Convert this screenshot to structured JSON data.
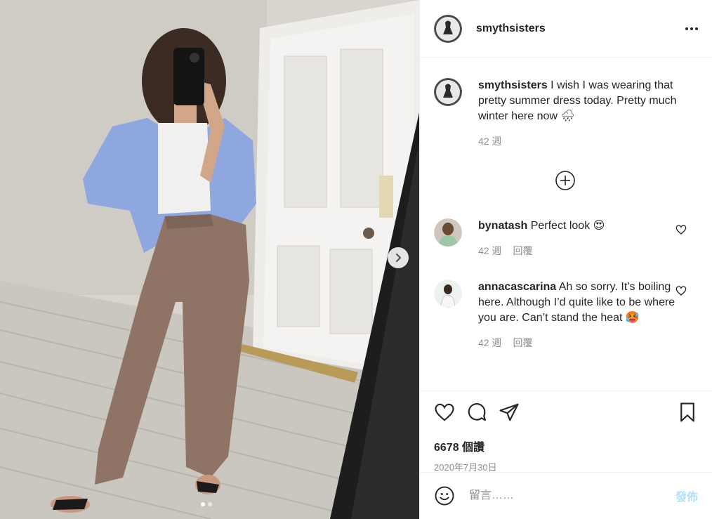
{
  "post": {
    "username": "smythsisters",
    "more_icon": "more-horizontal-icon"
  },
  "caption": {
    "username": "smythsisters",
    "text": "I wish I was wearing that pretty summer dress today. Pretty much winter here now 🌧",
    "time": "42 週"
  },
  "comments": [
    {
      "username": "bynatash",
      "text": "Perfect look 😍",
      "time": "42 週",
      "reply_label": "回覆"
    },
    {
      "username": "annacascarina",
      "text": "Ah so sorry. It’s boiling here. Although I’d quite like to be where you are. Can’t stand the heat 🥵",
      "time": "42 週",
      "reply_label": "回覆"
    }
  ],
  "likes": "6678 個讚",
  "date": "2020年7月30日",
  "comment_input": {
    "placeholder": "留言……",
    "post_label": "發佈"
  },
  "carousel": {
    "current": 1,
    "total": 2
  },
  "colors": {
    "post_button": "#b2dffc",
    "meta_text": "#8e8e8e",
    "text": "#262626"
  }
}
